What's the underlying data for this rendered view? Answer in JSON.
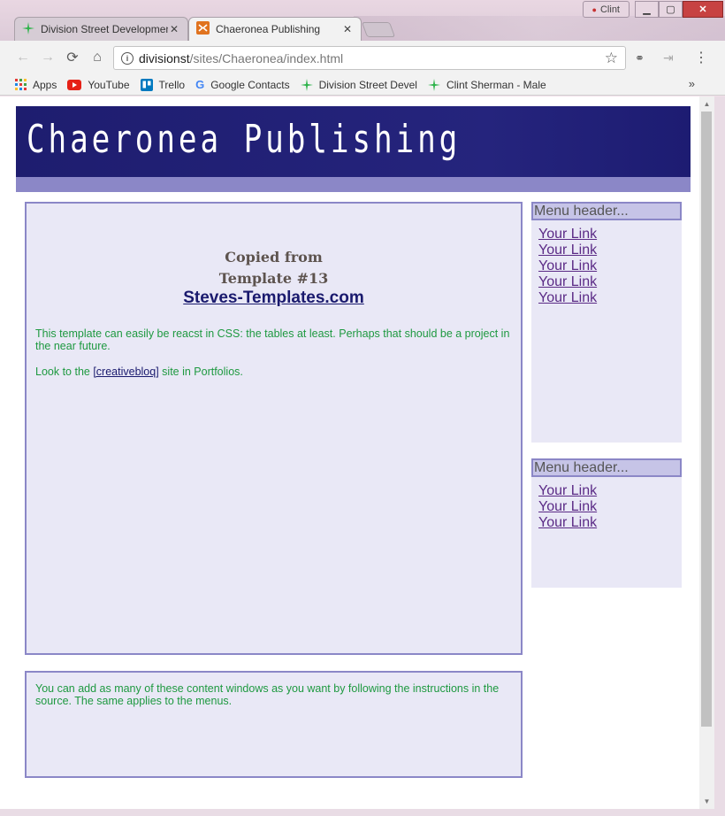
{
  "browser": {
    "tabs": [
      {
        "title": "Division Street Development",
        "active": false
      },
      {
        "title": "Chaeronea Publishing",
        "active": true
      }
    ],
    "user": "Clint",
    "url_host": "divisionst",
    "url_path": "/sites/Chaeronea/index.html",
    "bookmarks": [
      {
        "label": "Apps",
        "icon": "apps-grid-icon"
      },
      {
        "label": "YouTube",
        "icon": "youtube-icon"
      },
      {
        "label": "Trello",
        "icon": "trello-icon"
      },
      {
        "label": "Google Contacts",
        "icon": "google-icon"
      },
      {
        "label": "Division Street Devel",
        "icon": "sparkle-icon"
      },
      {
        "label": "Clint Sherman - Male",
        "icon": "sparkle-icon"
      }
    ],
    "bookmarks_more": "»"
  },
  "page": {
    "banner_title": "Chaeronea Publishing",
    "copied_line1": "Copied from",
    "copied_line2": "Template #13",
    "site_link": "Steves-Templates.com",
    "para1": "This template can easily be reacst in CSS: the tables at least. Perhaps that should be a project in the near future.",
    "para2_prefix": "Look to the ",
    "para2_link": "[creativebloq]",
    "para2_suffix": " site in Portfolios.",
    "para3": "You can add as many of these content windows as you want by following the instructions in the source. The same applies to the menus.",
    "menus": [
      {
        "header": "Menu header...",
        "links": [
          "Your Link",
          "Your Link",
          "Your Link",
          "Your Link",
          "Your Link"
        ]
      },
      {
        "header": "Menu header...",
        "links": [
          "Your Link",
          "Your Link",
          "Your Link"
        ]
      }
    ]
  },
  "colors": {
    "banner": "#25247d",
    "band": "#8b87c7",
    "content_bg": "#e9e8f6",
    "text_green": "#1e9940",
    "link_purple": "#5b2b86"
  }
}
